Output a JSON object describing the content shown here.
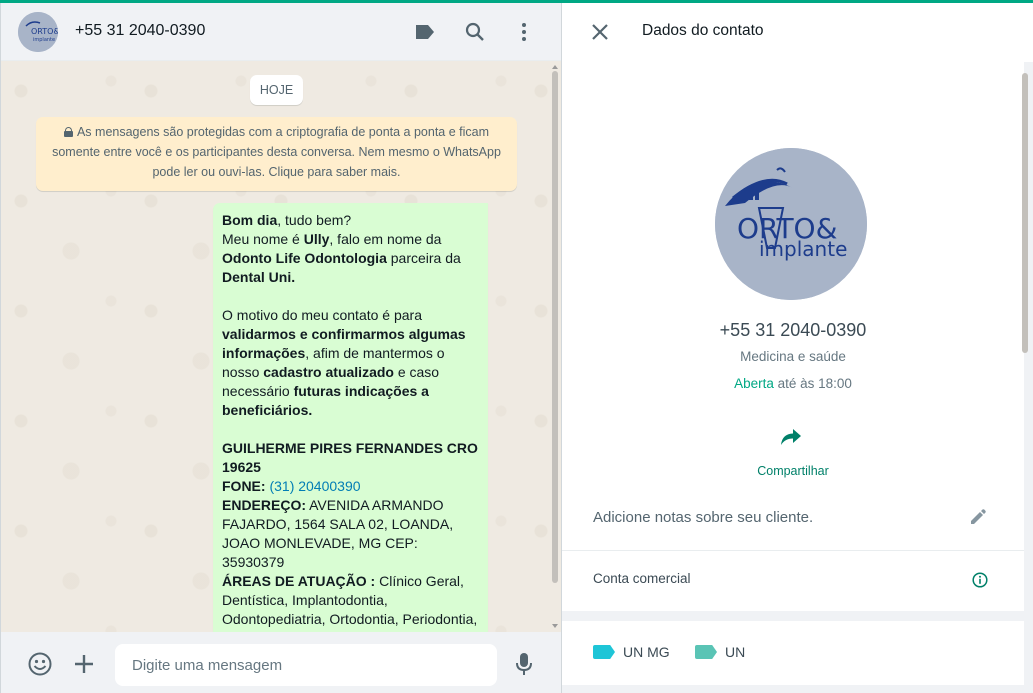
{
  "colors": {
    "accent": "#00a884",
    "bubble_out": "#d9fdd3",
    "crypto_notice": "#ffeecd",
    "link": "#027eb5",
    "label_un_mg": "#1ec5d7",
    "label_un": "#5ac4b5"
  },
  "chat": {
    "contact_title": "+55 31 2040-0390",
    "avatar": {
      "brand": "ORTO&",
      "sub": "implante"
    },
    "header_icons": [
      "label-icon",
      "search-icon",
      "menu-icon"
    ],
    "date_divider": "HOJE",
    "encryption_notice": "As mensagens são protegidas com a criptografia de ponta a ponta e ficam somente entre você e os participantes desta conversa. Nem mesmo o WhatsApp pode ler ou ouvi-las. Clique para saber mais.",
    "message": {
      "l1_b": "Bom dia",
      "l1_t": ", tudo bem?",
      "l2_t": "Meu nome é ",
      "l2_b": "Ully",
      "l2_t2": ", falo em nome da",
      "l3_b": "Odonto Life Odontologia",
      "l3_t": " parceira da",
      "l4_b": "Dental Uni.",
      "p2_t1": "O motivo do meu contato é para",
      "p2_b1": "validarmos e confirmarmos algumas informações",
      "p2_t2": ", afim de mantermos o nosso ",
      "p2_b2": "cadastro atualizado",
      "p2_t3": " e caso necessário ",
      "p2_b3": "futuras indicações a beneficiários.",
      "dentist_b": "GUILHERME PIRES FERNANDES CRO 19625",
      "fone_b": "FONE:",
      "fone_link": "(31) 20400390",
      "end_b": "ENDEREÇO:",
      "end_t": " AVENIDA ARMANDO FAJARDO, 1564 SALA 02, LOANDA, JOAO MONLEVADE, MG CEP: 35930379",
      "areas_b": "ÁREAS DE ATUAÇÃO :",
      "areas_t": " Clínico Geral, Dentística, Implantodontia, Odontopediatria, Ortodontia, Periodontia, Prótese Dentária,"
    },
    "composer": {
      "placeholder": "Digite uma mensagem",
      "value": ""
    }
  },
  "contact_info": {
    "title": "Dados do contato",
    "phone": "+55 31 2040-0390",
    "category": "Medicina e saúde",
    "hours_status": "Aberta",
    "hours_rest": " até às 18:00",
    "share_label": "Compartilhar",
    "notes_placeholder": "Adicione notas sobre seu cliente.",
    "business_account": "Conta comercial",
    "labels": [
      "UN MG",
      "UN"
    ]
  }
}
